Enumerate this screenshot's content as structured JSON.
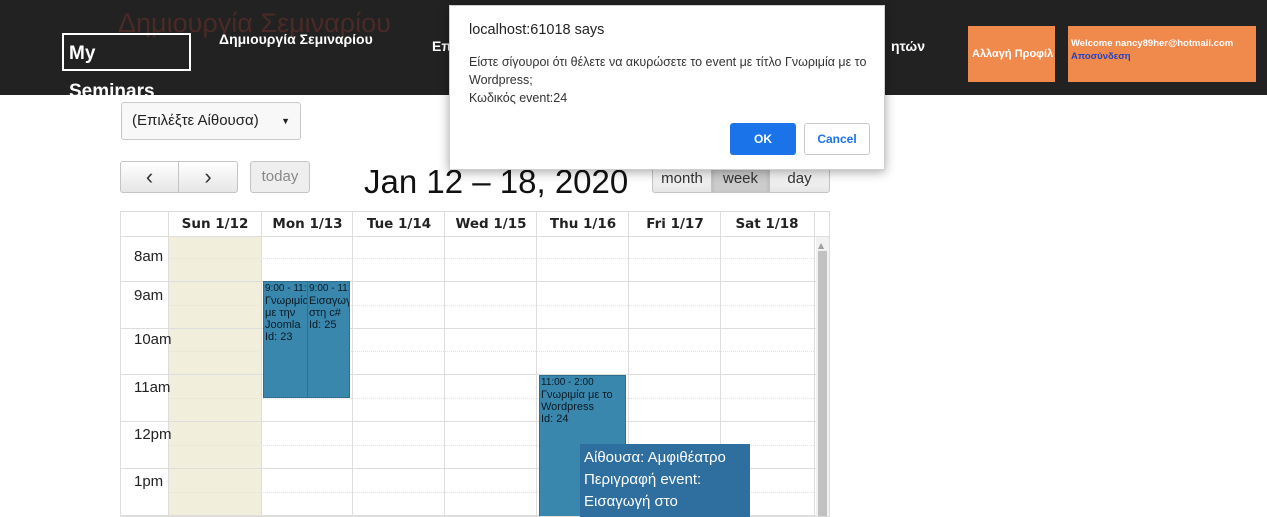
{
  "navbar": {
    "brand": "My Seminars",
    "ghost_title": "Δημιουργία Σεμιναρίου",
    "links": [
      "Δημιουργία Σεμιναρίου",
      "Επ",
      "ητών"
    ],
    "profile_button": "Αλλαγή Προφίλ",
    "welcome": "Welcome nancy89her@hotmail.com",
    "logout": "Αποσύνδεση",
    "colors": {
      "bar": "#222222",
      "accent": "#f0894c"
    }
  },
  "room_select": {
    "value": "(Επιλέξτε Αίθουσα)"
  },
  "toolbar": {
    "prev_icon": "‹",
    "next_icon": "›",
    "today_label": "today",
    "title": "Jan 12 – 18, 2020",
    "views": [
      "month",
      "week",
      "day"
    ],
    "active_view": "week"
  },
  "calendar": {
    "days": [
      "Sun 1/12",
      "Mon 1/13",
      "Tue 1/14",
      "Wed 1/15",
      "Thu 1/16",
      "Fri 1/17",
      "Sat 1/18"
    ],
    "times": [
      "8am",
      "9am",
      "10am",
      "11am",
      "12pm",
      "1pm"
    ],
    "today": "Sun 1/12",
    "events": [
      {
        "time": "9:00 - 11:00",
        "title": "Γνωριμία με την Joomla",
        "id_label": "Id: 23",
        "day": "Mon 1/13",
        "color": "#3a87ad"
      },
      {
        "time": "9:00 - 11:00",
        "title": "Εισαγωγή στη c#",
        "id_label": "Id: 25",
        "day": "Mon 1/13",
        "color": "#3a87ad"
      },
      {
        "time": "11:00 - 2:00",
        "title": "Γνωριμία με το Wordpress",
        "id_label": "Id: 24",
        "day": "Thu 1/16",
        "color": "#3a87ad"
      }
    ]
  },
  "tooltip": {
    "room": "Αίθουσα: Αμφιθέατρο",
    "desc_label": "Περιγραφή event:",
    "desc": "Εισαγωγή στο wordpress"
  },
  "dialog": {
    "title": "localhost:61018 says",
    "message": "Είστε σίγουροι ότι θέλετε να ακυρώσετε το event με τίτλο Γνωριμία με το Wordpress;\n Κωδικός event:24",
    "ok": "OK",
    "cancel": "Cancel"
  }
}
